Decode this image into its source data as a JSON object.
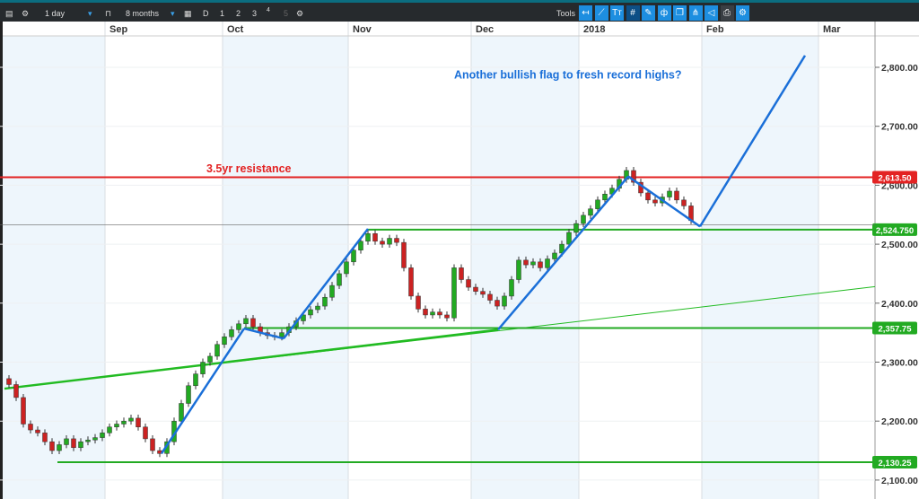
{
  "toolbar": {
    "interval": "1 day",
    "range": "8 months",
    "buttons": [
      "D",
      "1",
      "2",
      "3",
      "4",
      "5"
    ],
    "tools_label": "Tools",
    "tool_icons": [
      "arrow-left-icon",
      "trendline-icon",
      "text-icon",
      "grid-icon",
      "pencil-icon",
      "candle-icon",
      "windows-icon",
      "fork-icon",
      "tag-icon",
      "print-icon",
      "settings-tool-icon"
    ]
  },
  "chart_data": {
    "type": "candlestick",
    "x_labels": [
      "Sep",
      "Oct",
      "Nov",
      "Dec",
      "2018",
      "Feb",
      "Mar"
    ],
    "y_ticks": [
      "2,100.00",
      "2,200.00",
      "2,300.00",
      "2,400.00",
      "2,500.00",
      "2,600.00",
      "2,700.00",
      "2,800.00"
    ],
    "ylim": [
      2080,
      2860
    ],
    "closes": [
      2262,
      2240,
      2195,
      2185,
      2180,
      2165,
      2150,
      2160,
      2170,
      2155,
      2165,
      2168,
      2172,
      2180,
      2190,
      2195,
      2200,
      2205,
      2190,
      2170,
      2150,
      2145,
      2165,
      2200,
      2230,
      2260,
      2280,
      2300,
      2310,
      2330,
      2343,
      2355,
      2365,
      2374,
      2360,
      2350,
      2345,
      2343,
      2350,
      2360,
      2370,
      2380,
      2389,
      2395,
      2410,
      2430,
      2450,
      2470,
      2490,
      2505,
      2518,
      2505,
      2500,
      2510,
      2503,
      2460,
      2412,
      2390,
      2380,
      2385,
      2380,
      2375,
      2460,
      2440,
      2427,
      2420,
      2415,
      2405,
      2395,
      2412,
      2440,
      2473,
      2465,
      2470,
      2460,
      2475,
      2485,
      2500,
      2520,
      2535,
      2549,
      2560,
      2575,
      2585,
      2595,
      2610,
      2625,
      2605,
      2587,
      2575,
      2570,
      2580,
      2590,
      2575,
      2565,
      2540
    ],
    "levels": [
      {
        "label": "2,613.50",
        "value": 2613.5,
        "color": "#e32222"
      },
      {
        "label": "2,524.750",
        "value": 2524.75,
        "color": "#22aa22"
      },
      {
        "label": "2,357.75",
        "value": 2357.75,
        "color": "#22aa22"
      },
      {
        "label": "2,130.25",
        "value": 2130.25,
        "color": "#22aa22"
      }
    ],
    "annotations": {
      "resistance": "3.5yr resistance",
      "question": "Another bullish flag to fresh record highs?"
    },
    "colors": {
      "up": "#22aa22",
      "down": "#cc2222",
      "annotation": "#1a6fd8"
    }
  }
}
